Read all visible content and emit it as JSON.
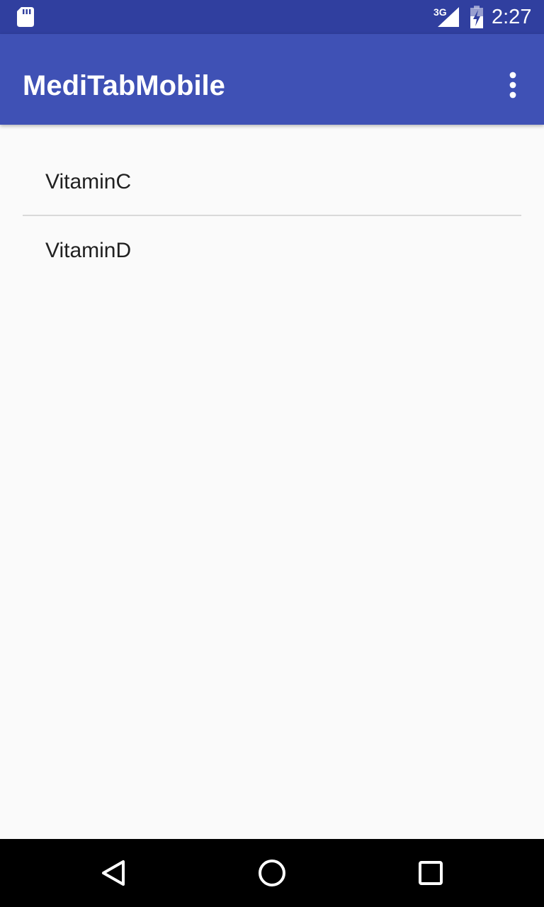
{
  "status_bar": {
    "network_type": "3G",
    "time": "2:27",
    "icons": [
      "sd-card-icon",
      "cell-signal-icon",
      "battery-charging-icon"
    ]
  },
  "app_bar": {
    "title": "MediTabMobile",
    "overflow_icon": "more-vert-icon",
    "background_color": "#3f51b5"
  },
  "list": {
    "items": [
      {
        "label": "VitaminC"
      },
      {
        "label": "VitaminD"
      }
    ]
  },
  "navigation_bar": {
    "icons": [
      "back-icon",
      "home-icon",
      "recents-icon"
    ]
  },
  "colors": {
    "status_bar": "#303f9f",
    "app_bar": "#3f51b5",
    "background": "#fafafa",
    "divider": "#d9d9d9",
    "text_primary": "#212121"
  }
}
